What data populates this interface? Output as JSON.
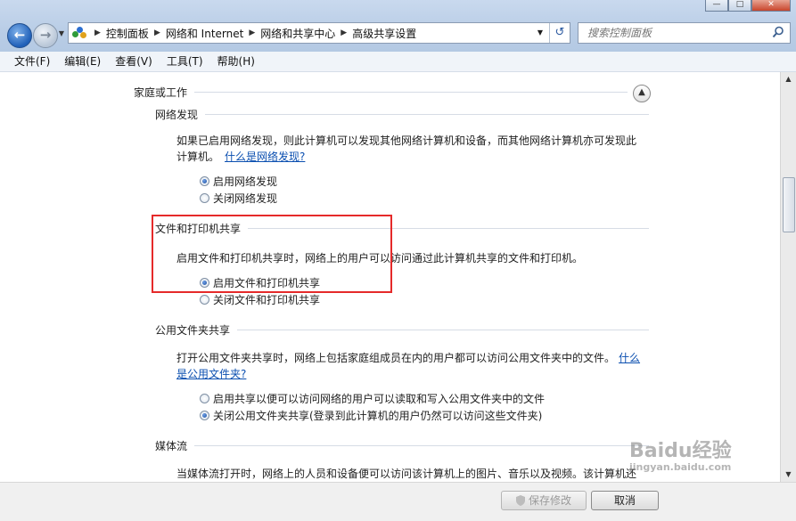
{
  "window": {
    "controls": [
      "—",
      "□",
      "✕"
    ]
  },
  "address_bar": {
    "crumbs": [
      "控制面板",
      "网络和 Internet",
      "网络和共享中心",
      "高级共享设置"
    ]
  },
  "search": {
    "placeholder": "搜索控制面板"
  },
  "menu": [
    "文件(F)",
    "编辑(E)",
    "查看(V)",
    "工具(T)",
    "帮助(H)"
  ],
  "profile": {
    "title": "家庭或工作"
  },
  "sections": {
    "network_discovery": {
      "title": "网络发现",
      "desc_line1": "如果已启用网络发现，则此计算机可以发现其他网络计算机和设备，而其他网络计算机亦可发现此",
      "desc_line2": "计算机。",
      "link": "什么是网络发现?",
      "options": [
        "启用网络发现",
        "关闭网络发现"
      ],
      "selected_index": 0
    },
    "file_printer_sharing": {
      "title": "文件和打印机共享",
      "desc": "启用文件和打印机共享时，网络上的用户可以访问通过此计算机共享的文件和打印机。",
      "options": [
        "启用文件和打印机共享",
        "关闭文件和打印机共享"
      ],
      "selected_index": 0
    },
    "public_folder_sharing": {
      "title": "公用文件夹共享",
      "desc_line1": "打开公用文件夹共享时，网络上包括家庭组成员在内的用户都可以访问公用文件夹中的文件。",
      "link_part1": "什么",
      "link_part2": "是公用文件夹?",
      "options": [
        "启用共享以便可以访问网络的用户可以读取和写入公用文件夹中的文件",
        "关闭公用文件夹共享(登录到此计算机的用户仍然可以访问这些文件夹)"
      ],
      "selected_index": 1
    },
    "media_streaming": {
      "title": "媒体流",
      "desc_line1": "当媒体流打开时，网络上的人员和设备便可以访问该计算机上的图片、音乐以及视频。该计算机还"
    }
  },
  "footer": {
    "save_label": "保存修改",
    "cancel_label": "取消"
  },
  "watermark": {
    "text": "Baidu经验",
    "sub": "jingyan.baidu.com"
  },
  "colors": {
    "link": "#0b4fb0",
    "highlight": "#e52a2a"
  }
}
